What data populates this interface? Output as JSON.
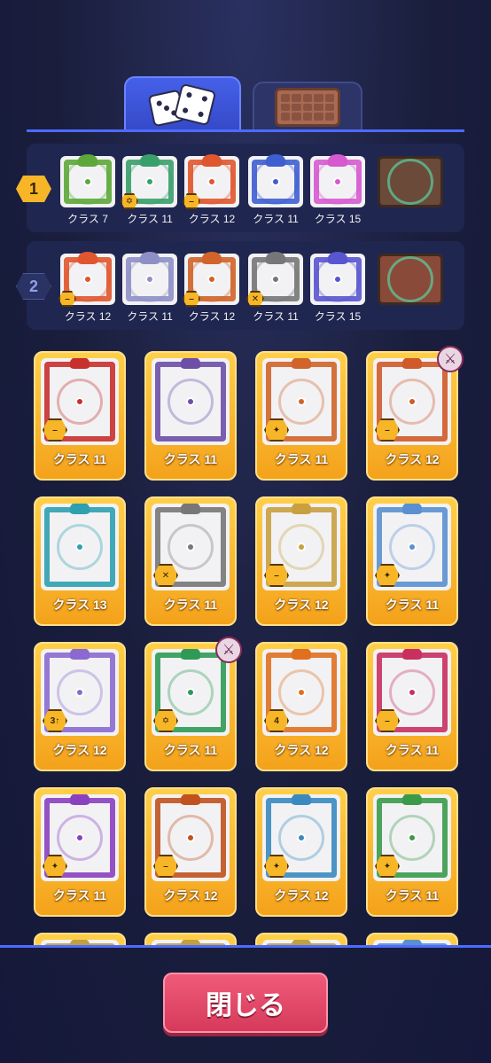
{
  "tabs": [
    {
      "name": "dice",
      "icon": "dice-icon",
      "active": true
    },
    {
      "name": "board",
      "icon": "board-icon",
      "active": false
    }
  ],
  "decks": [
    {
      "number": "1",
      "active": true,
      "slots": [
        {
          "label": "クラス 7",
          "color": "#5da83a",
          "icon": "vine-dice-icon"
        },
        {
          "label": "クラス 11",
          "color": "#3aa06b",
          "icon": "star-dice-icon",
          "badge": "✡"
        },
        {
          "label": "クラス 12",
          "color": "#e0562e",
          "icon": "infinity-dice-icon",
          "badge": "–"
        },
        {
          "label": "クラス 11",
          "color": "#3f5fd0",
          "icon": "wave-dice-icon"
        },
        {
          "label": "クラス 15",
          "color": "#d65ad0",
          "icon": "rainbow-dice-icon"
        },
        {
          "label": "",
          "color": "#6b4a3a",
          "icon": "board-icon"
        }
      ]
    },
    {
      "number": "2",
      "active": false,
      "slots": [
        {
          "label": "クラス 12",
          "color": "#e0562e",
          "icon": "infinity-dice-icon",
          "badge": "–"
        },
        {
          "label": "クラス 11",
          "color": "#8f8fc8",
          "icon": "tornado-dice-icon"
        },
        {
          "label": "クラス 12",
          "color": "#d0642a",
          "icon": "sniper-dice-icon",
          "badge": "–"
        },
        {
          "label": "クラス 11",
          "color": "#777777",
          "icon": "skull-dice-icon",
          "badge": "✕"
        },
        {
          "label": "クラス 15",
          "color": "#5a55d0",
          "icon": "mirror-dice-icon"
        },
        {
          "label": "",
          "color": "#8a4a3a",
          "icon": "board-icon"
        }
      ]
    }
  ],
  "cards": [
    {
      "label": "クラス 11",
      "color": "#c8302e",
      "icon": "sun-dice-icon",
      "badge": "–"
    },
    {
      "label": "クラス 11",
      "color": "#6d4fa8",
      "icon": "gear-dice-icon"
    },
    {
      "label": "クラス 11",
      "color": "#d0642a",
      "icon": "fire-dice-icon",
      "badge": "✦"
    },
    {
      "label": "クラス 12",
      "color": "#d05a2a",
      "icon": "infinity-dice-icon",
      "badge": "–",
      "sword": true
    },
    {
      "label": "クラス 13",
      "color": "#2ea0b0",
      "icon": "sword-dice-icon"
    },
    {
      "label": "クラス 11",
      "color": "#777777",
      "icon": "skull-dice-icon",
      "badge": "✕"
    },
    {
      "label": "クラス 12",
      "color": "#c9a040",
      "icon": "shield-dice-icon",
      "badge": "–"
    },
    {
      "label": "クラス 11",
      "color": "#5a90d0",
      "icon": "snow-dice-icon",
      "badge": "✦"
    },
    {
      "label": "クラス 12",
      "color": "#8a6ad0",
      "icon": "cycle-dice-icon",
      "badge": "3↑"
    },
    {
      "label": "クラス 11",
      "color": "#2f9a56",
      "icon": "pentagram-dice-icon",
      "badge": "✡",
      "sword": true
    },
    {
      "label": "クラス 12",
      "color": "#e07020",
      "icon": "blaze-dice-icon",
      "badge": "4"
    },
    {
      "label": "クラス 11",
      "color": "#c83060",
      "icon": "blade-dice-icon",
      "badge": "–"
    },
    {
      "label": "クラス 11",
      "color": "#8a40c0",
      "icon": "atom-dice-icon",
      "badge": "✦"
    },
    {
      "label": "クラス 12",
      "color": "#c0521e",
      "icon": "sniper-dice-icon",
      "badge": "–"
    },
    {
      "label": "クラス 12",
      "color": "#3a8ac0",
      "icon": "vortex-dice-icon",
      "badge": "✦"
    },
    {
      "label": "クラス 11",
      "color": "#3a9a4a",
      "icon": "thorn-dice-icon",
      "badge": "✦"
    },
    {
      "label": "",
      "color": "#c0a040",
      "icon": "partial-dice-icon"
    },
    {
      "label": "",
      "color": "#c0a040",
      "icon": "partial-dice-icon"
    },
    {
      "label": "",
      "color": "#c0a040",
      "icon": "partial-dice-icon"
    },
    {
      "label": "",
      "color": "#5a90d0",
      "icon": "partial-dice-icon"
    }
  ],
  "close_button": {
    "label": "閉じる"
  }
}
